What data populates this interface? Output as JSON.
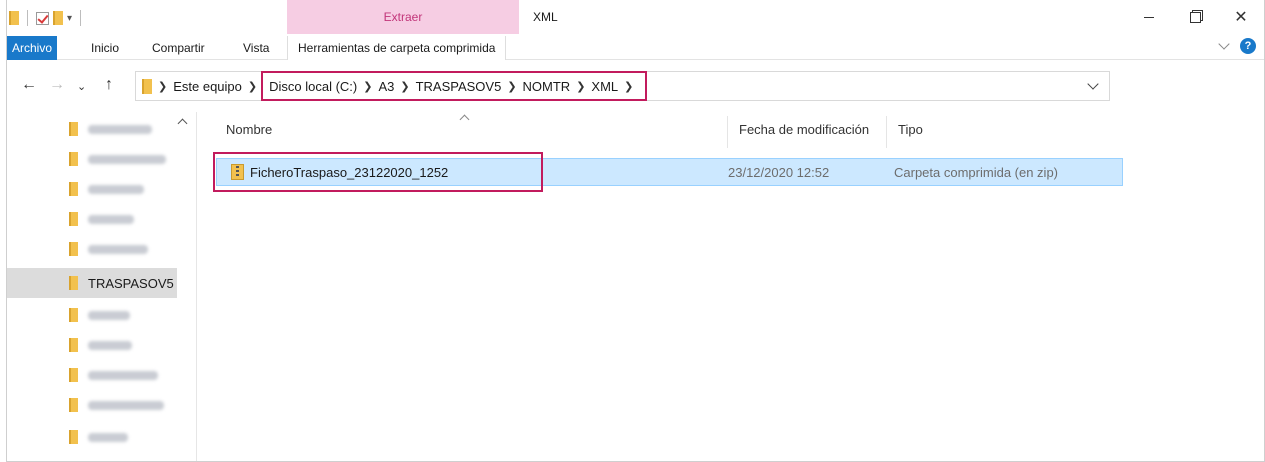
{
  "window": {
    "title": "XML",
    "context_tab_group": "Extraer"
  },
  "ribbon": {
    "tabs": [
      {
        "label": "Archivo"
      },
      {
        "label": "Inicio"
      },
      {
        "label": "Compartir"
      },
      {
        "label": "Vista"
      },
      {
        "label": "Herramientas de carpeta comprimida"
      }
    ],
    "help_label": "?"
  },
  "address": {
    "crumbs": [
      "Este equipo",
      "Disco local (C:)",
      "A3",
      "TRASPASOV5",
      "NOMTR",
      "XML"
    ],
    "highlight_color": "#c21b5d"
  },
  "navpane": {
    "selected_label": "TRASPASOV5"
  },
  "columns": {
    "name": "Nombre",
    "date": "Fecha de modificación",
    "type": "Tipo"
  },
  "files": [
    {
      "name": "FicheroTraspaso_23122020_1252",
      "date": "23/12/2020 12:52",
      "type": "Carpeta comprimida (en zip)",
      "icon": "zip-folder-icon"
    }
  ],
  "colors": {
    "accent": "#1979ca",
    "context_tab_bg": "#f6cde3",
    "selection_bg": "#cce8ff"
  }
}
